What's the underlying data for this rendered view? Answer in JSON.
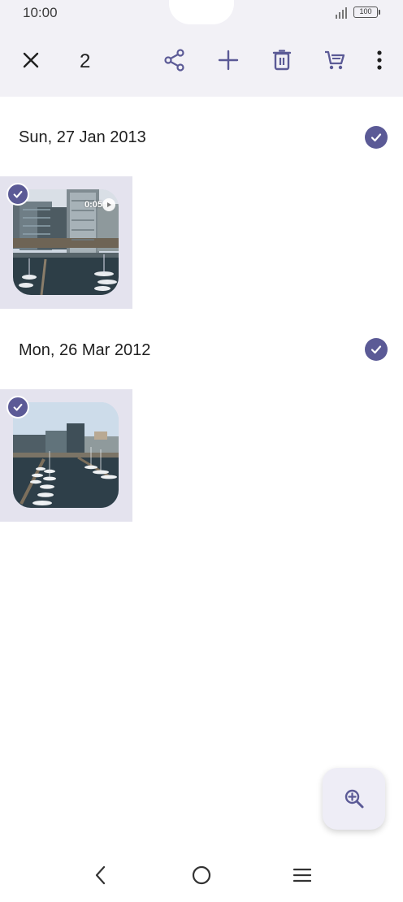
{
  "status_bar": {
    "time": "10:00",
    "battery": "100"
  },
  "toolbar": {
    "selected_count": "2",
    "icons": [
      "close-icon",
      "share-icon",
      "add-icon",
      "delete-icon",
      "cart-icon",
      "more-vert-icon"
    ]
  },
  "sections": [
    {
      "date": "Sun, 27 Jan 2013",
      "items": [
        {
          "type": "video",
          "duration": "0:05",
          "selected": true
        }
      ]
    },
    {
      "date": "Mon, 26 Mar 2012",
      "items": [
        {
          "type": "photo",
          "selected": true
        }
      ]
    }
  ],
  "fab": {
    "icon": "zoom-in-icon"
  },
  "nav_bar": {
    "icons": [
      "back-icon",
      "home-icon",
      "menu-icon"
    ]
  },
  "colors": {
    "accent": "#5b5a96",
    "header_bg": "#f2f1f6",
    "tile_bg": "#e4e3ee"
  }
}
